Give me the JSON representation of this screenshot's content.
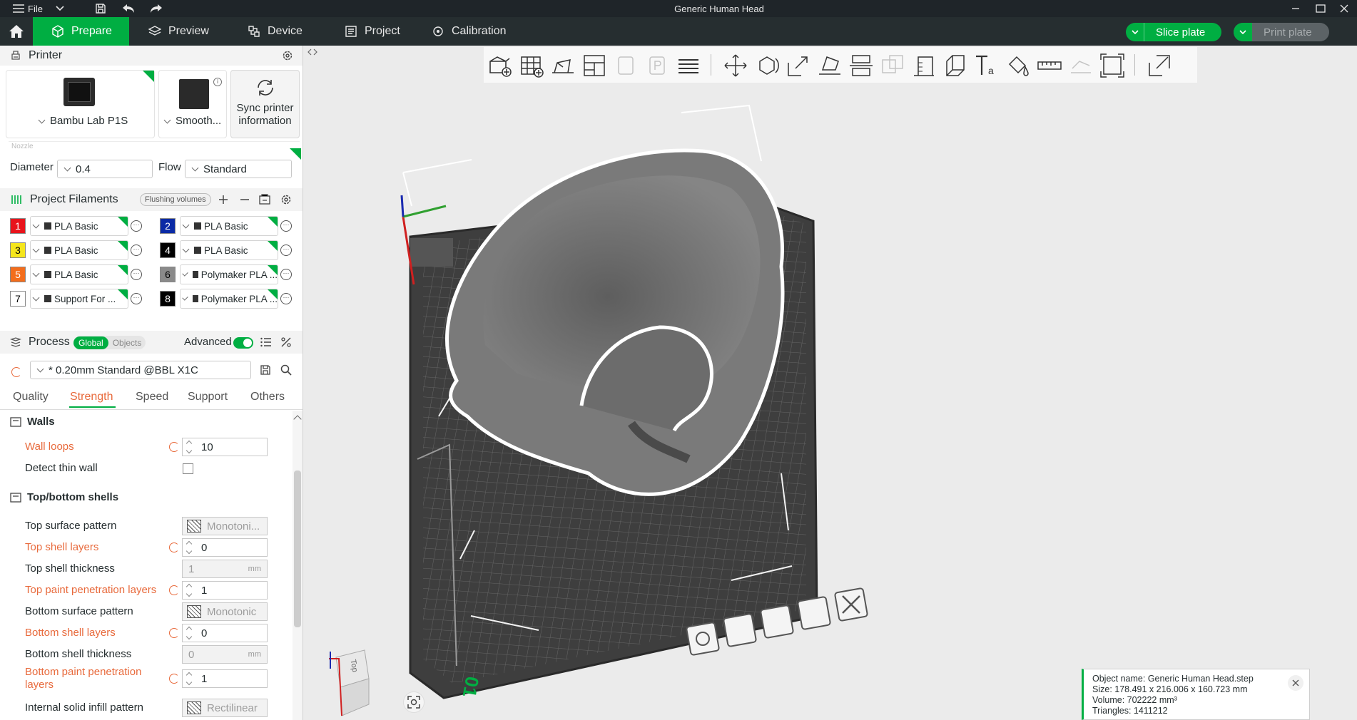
{
  "window": {
    "title": "Generic Human Head",
    "file_menu": "File"
  },
  "topbar": {
    "tabs": [
      {
        "label": "Prepare",
        "active": true
      },
      {
        "label": "Preview"
      },
      {
        "label": "Device"
      },
      {
        "label": "Project"
      },
      {
        "label": "Calibration"
      }
    ],
    "slice_label": "Slice plate",
    "print_label": "Print plate"
  },
  "printer": {
    "section_title": "Printer",
    "printer_name": "Bambu Lab P1S",
    "plate_name": "Smooth...",
    "sync_label": "Sync printer information",
    "nozzle_label": "Nozzle",
    "diameter_label": "Diameter",
    "diameter_value": "0.4",
    "flow_label": "Flow",
    "flow_value": "Standard"
  },
  "filaments": {
    "section_title": "Project Filaments",
    "flushing_label": "Flushing volumes",
    "items": [
      {
        "num": "1",
        "color": "#e8141c",
        "text_color": "#ffffff",
        "name": "PLA Basic"
      },
      {
        "num": "2",
        "color": "#0a2aa5",
        "text_color": "#ffffff",
        "name": "PLA Basic"
      },
      {
        "num": "3",
        "color": "#f5e61c",
        "text_color": "#000000",
        "name": "PLA Basic"
      },
      {
        "num": "4",
        "color": "#000000",
        "text_color": "#ffffff",
        "name": "PLA Basic"
      },
      {
        "num": "5",
        "color": "#f36d1c",
        "text_color": "#ffffff",
        "name": "PLA Basic"
      },
      {
        "num": "6",
        "color": "#8a8a8a",
        "text_color": "#000000",
        "name": "Polymaker PLA ..."
      },
      {
        "num": "7",
        "color": "#ffffff",
        "text_color": "#000000",
        "name": "Support For ..."
      },
      {
        "num": "8",
        "color": "#000000",
        "text_color": "#ffffff",
        "name": "Polymaker PLA ..."
      }
    ]
  },
  "process": {
    "section_title": "Process",
    "global_label": "Global",
    "objects_label": "Objects",
    "advanced_label": "Advanced",
    "preset": "* 0.20mm Standard @BBL X1C",
    "tabs": [
      "Quality",
      "Strength",
      "Speed",
      "Support",
      "Others"
    ],
    "active_tab": "Strength"
  },
  "settings": {
    "walls_title": "Walls",
    "wall_loops_label": "Wall loops",
    "wall_loops_value": "10",
    "detect_thin_wall_label": "Detect thin wall",
    "topbottom_title": "Top/bottom shells",
    "top_surface_pattern_label": "Top surface pattern",
    "top_surface_pattern_value": "Monotoni...",
    "top_shell_layers_label": "Top shell layers",
    "top_shell_layers_value": "0",
    "top_shell_thickness_label": "Top shell thickness",
    "top_shell_thickness_value": "1",
    "unit_mm": "mm",
    "top_paint_label": "Top paint penetration layers",
    "top_paint_value": "1",
    "bottom_surface_pattern_label": "Bottom surface pattern",
    "bottom_surface_pattern_value": "Monotonic",
    "bottom_shell_layers_label": "Bottom shell layers",
    "bottom_shell_layers_value": "0",
    "bottom_shell_thickness_label": "Bottom shell thickness",
    "bottom_shell_thickness_value": "0",
    "bottom_paint_label": "Bottom paint penetration layers",
    "bottom_paint_value": "1",
    "internal_solid_label": "Internal solid infill pattern",
    "internal_solid_value": "Rectilinear"
  },
  "viewport": {
    "plate_number": "01",
    "cube_face": "Top",
    "object_info": {
      "name": "Object name: Generic Human Head.step",
      "size": "Size: 178.491 x 216.006 x 160.723 mm",
      "volume": "Volume: 702222 mm³",
      "triangles": "Triangles: 1411212"
    }
  }
}
